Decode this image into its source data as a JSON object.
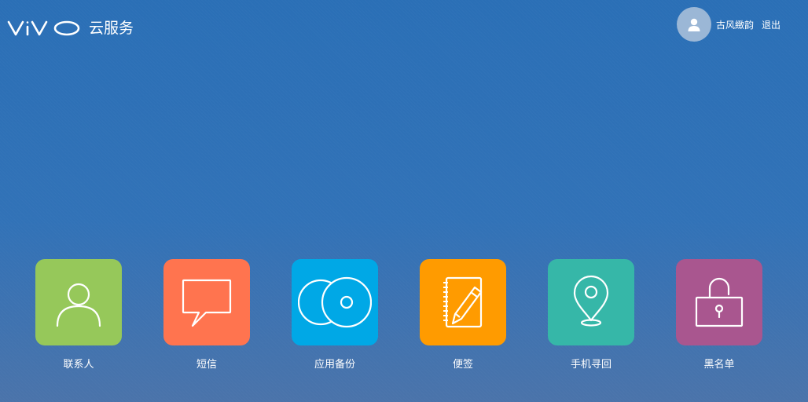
{
  "header": {
    "brand": "vivo",
    "service_name": "云服务",
    "user": {
      "name": "古风緻韵",
      "logout_label": "退出"
    }
  },
  "apps": [
    {
      "label": "联系人",
      "icon": "contacts-icon",
      "color": "#96c85a"
    },
    {
      "label": "短信",
      "icon": "message-icon",
      "color": "#ff744f"
    },
    {
      "label": "应用备份",
      "icon": "app-backup-icon",
      "color": "#00a8e6"
    },
    {
      "label": "便签",
      "icon": "notes-icon",
      "color": "#ff9b00"
    },
    {
      "label": "手机寻回",
      "icon": "find-phone-icon",
      "color": "#36b7a8"
    },
    {
      "label": "黑名单",
      "icon": "blacklist-icon",
      "color": "#a9568f"
    }
  ]
}
